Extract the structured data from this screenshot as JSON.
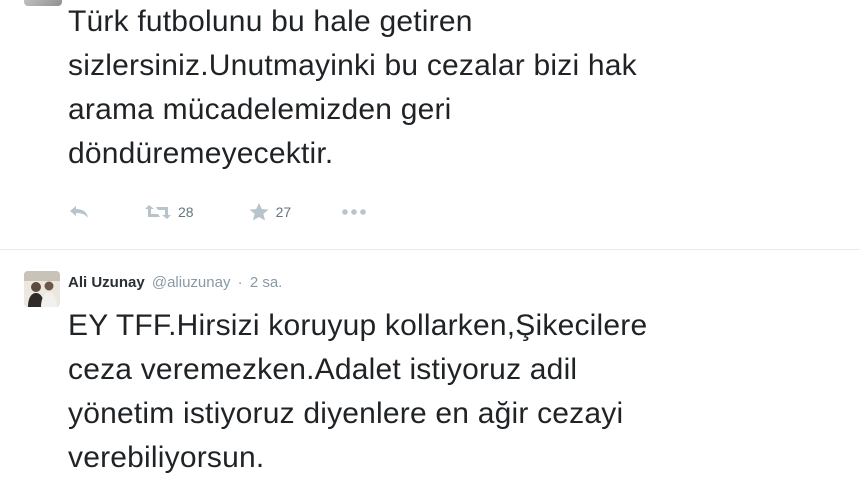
{
  "tweet1": {
    "text": "Türk futbolunu bu hale getiren\nsizlersiniz.Unutmayinki bu cezalar bizi hak\narama mücadelemizden geri\ndöndüremeyecektir.",
    "actions": {
      "reply_icon": "reply-icon",
      "retweet_icon": "retweet-icon",
      "retweet_count": "28",
      "favorite_icon": "star-icon",
      "favorite_count": "27",
      "more_icon": "more-icon"
    }
  },
  "tweet2": {
    "fullname": "Ali Uzunay",
    "username": "@aliuzunay",
    "separator": "·",
    "time": "2 sa.",
    "text": "EY TFF.Hirsizi koruyup kollarken,Şikecilere\nceza veremezken.Adalet istiyoruz adil\nyönetim istiyoruz diyenlere en ağir cezayi\nverebiliyorsun."
  },
  "colors": {
    "icon_gray": "#8899a6",
    "divider": "#e6ecf0",
    "text": "#1f2326"
  }
}
